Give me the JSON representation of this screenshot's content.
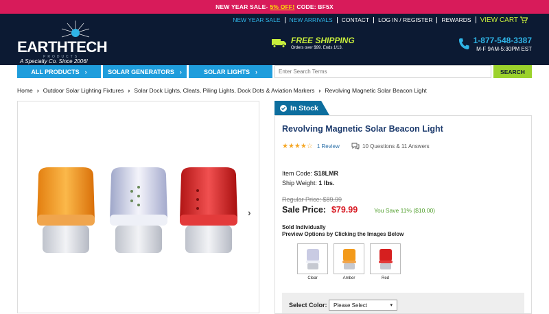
{
  "promo": {
    "prefix": "NEW YEAR SALE",
    "dash": " -",
    "offer": "5% OFF!",
    "code": "CODE: BF5X"
  },
  "header": {
    "logo": {
      "earth": "EARTH",
      "tech": "TECH",
      "products": "PRODUCTS",
      "tagline": "A Specialty Co. Since 2006!"
    },
    "topnav": [
      {
        "label": "NEW YEAR SALE",
        "accent": true
      },
      {
        "label": "NEW ARRIVALS",
        "accent": true
      },
      {
        "label": "CONTACT",
        "accent": false
      },
      {
        "label": "LOG IN / REGISTER",
        "accent": false
      },
      {
        "label": "REWARDS",
        "accent": false
      }
    ],
    "cart_label": "VIEW CART",
    "shipping": {
      "title": "FREE SHIPPING",
      "subtitle": "Orders over $99. Ends 1/13."
    },
    "phone": {
      "number": "1-877-548-3387",
      "hours": "M-F 9AM-5:30PM EST"
    }
  },
  "navbar": {
    "items": [
      "ALL PRODUCTS",
      "SOLAR GENERATORS",
      "SOLAR LIGHTS"
    ],
    "search_placeholder": "Enter Search Terms",
    "search_button": "SEARCH"
  },
  "breadcrumb": [
    "Home",
    "Outdoor Solar Lighting Fixtures",
    "Solar Dock Lights, Cleats, Piling Lights, Dock Dots & Aviation Markers",
    "Revolving Magnetic Solar Beacon Light"
  ],
  "product": {
    "stock": "In Stock",
    "title": "Revolving Magnetic Solar Beacon Light",
    "rating": 4,
    "reviews": "1 Review",
    "qa": "10 Questions & 11 Answers",
    "item_code_label": "Item Code:",
    "item_code": "S18LMR",
    "ship_weight_label": "Ship Weight:",
    "ship_weight": "1 lbs.",
    "regular_price": "Regular Price: $89.99",
    "sale_label": "Sale Price:",
    "sale_price": "$79.99",
    "you_save": "You Save 11% ($10.00)",
    "sold": "Sold Individually",
    "preview": "Preview Options by Clicking the Images Below",
    "options": [
      {
        "label": "Clear",
        "color": "#c9cbe3"
      },
      {
        "label": "Amber",
        "color": "#f39a1a"
      },
      {
        "label": "Red",
        "color": "#d61f1f"
      }
    ],
    "select_color_label": "Select Color:",
    "select_placeholder": "Please Select"
  },
  "colors": {
    "brand_pink": "#d81b5a",
    "nav_blue": "#1f9ddc",
    "header_dark": "#0c1a33",
    "accent_green": "#9bd22c",
    "price_red": "#d81b24"
  }
}
